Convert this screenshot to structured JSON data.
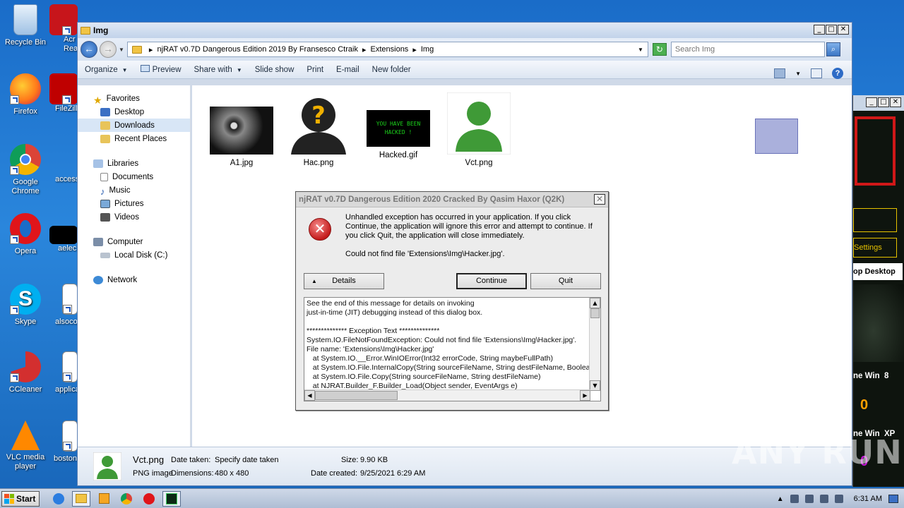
{
  "desktop": {
    "icons": [
      {
        "label": "Recycle Bin"
      },
      {
        "label": "Firefox"
      },
      {
        "label": "Google Chrome"
      },
      {
        "label": "Opera"
      },
      {
        "label": "Skype"
      },
      {
        "label": "CCleaner"
      },
      {
        "label": "VLC media player"
      },
      {
        "label": "Acr Read"
      },
      {
        "label": "FileZill"
      },
      {
        "label": "access"
      },
      {
        "label": "aelec"
      },
      {
        "label": "alsoco"
      },
      {
        "label": "applica"
      },
      {
        "label": "boston"
      }
    ]
  },
  "explorer": {
    "title": "Img",
    "address": {
      "crumbs": [
        "njRAT v0.7D Dangerous Edition 2019 By Fransesco Ctraik",
        "Extensions",
        "Img"
      ],
      "separator": "▸"
    },
    "search_placeholder": "Search Img",
    "toolbar": {
      "organize": "Organize",
      "preview": "Preview",
      "share_with": "Share with",
      "slide_show": "Slide show",
      "print": "Print",
      "email": "E-mail",
      "new_folder": "New folder"
    },
    "nav": {
      "favorites": "Favorites",
      "desktop": "Desktop",
      "downloads": "Downloads",
      "recent": "Recent Places",
      "libraries": "Libraries",
      "documents": "Documents",
      "music": "Music",
      "pictures": "Pictures",
      "videos": "Videos",
      "computer": "Computer",
      "local_disk": "Local Disk (C:)",
      "network": "Network"
    },
    "files": [
      {
        "name": "A1.jpg"
      },
      {
        "name": "Hac.png"
      },
      {
        "name": "Hacked.gif",
        "thumb_text": "YOU HAVE BEEN HACKED !"
      },
      {
        "name": "Vct.png"
      }
    ],
    "details": {
      "name": "Vct.png",
      "date_taken_label": "Date taken:",
      "date_taken": "Specify date taken",
      "size_label": "Size:",
      "size": "9.90 KB",
      "type": "PNG image",
      "dimensions_label": "Dimensions:",
      "dimensions": "480 x 480",
      "date_created_label": "Date created:",
      "date_created": "9/25/2021 6:29 AM"
    }
  },
  "dialog": {
    "title": "njRAT v0.7D Dangerous Edition 2020 Cracked By Qasim Haxor (Q2K)",
    "message": "Unhandled exception has occurred in your application. If you click Continue, the application will ignore this error and attempt to continue. If you click Quit, the application will close immediately.",
    "detail": "Could not find file 'Extensions\\Img\\Hacker.jpg'.",
    "buttons": {
      "details": "Details",
      "continue": "Continue",
      "quit": "Quit"
    },
    "trace": "See the end of this message for details on invoking\njust-in-time (JIT) debugging instead of this dialog box.\n\n************** Exception Text **************\nSystem.IO.FileNotFoundException: Could not find file 'Extensions\\Img\\Hacker.jpg'.\nFile name: 'Extensions\\Img\\Hacker.jpg'\n   at System.IO.__Error.WinIOError(Int32 errorCode, String maybeFullPath)\n   at System.IO.File.InternalCopy(String sourceFileName, String destFileName, Boolean overwrite, Boolean checkHost)\n   at System.IO.File.Copy(String sourceFileName, String destFileName)\n   at NJRAT.Builder_F.Builder_Load(Object sender, EventArgs e)"
  },
  "right_window": {
    "settings": "Settings",
    "remote": "op Desktop",
    "win8": "ne Win  8",
    "win8_count": "0",
    "winxp": "ne Win  XP",
    "winxp_count": "0"
  },
  "watermark": "ANY RUN",
  "taskbar": {
    "start": "Start",
    "clock": "6:31 AM"
  }
}
